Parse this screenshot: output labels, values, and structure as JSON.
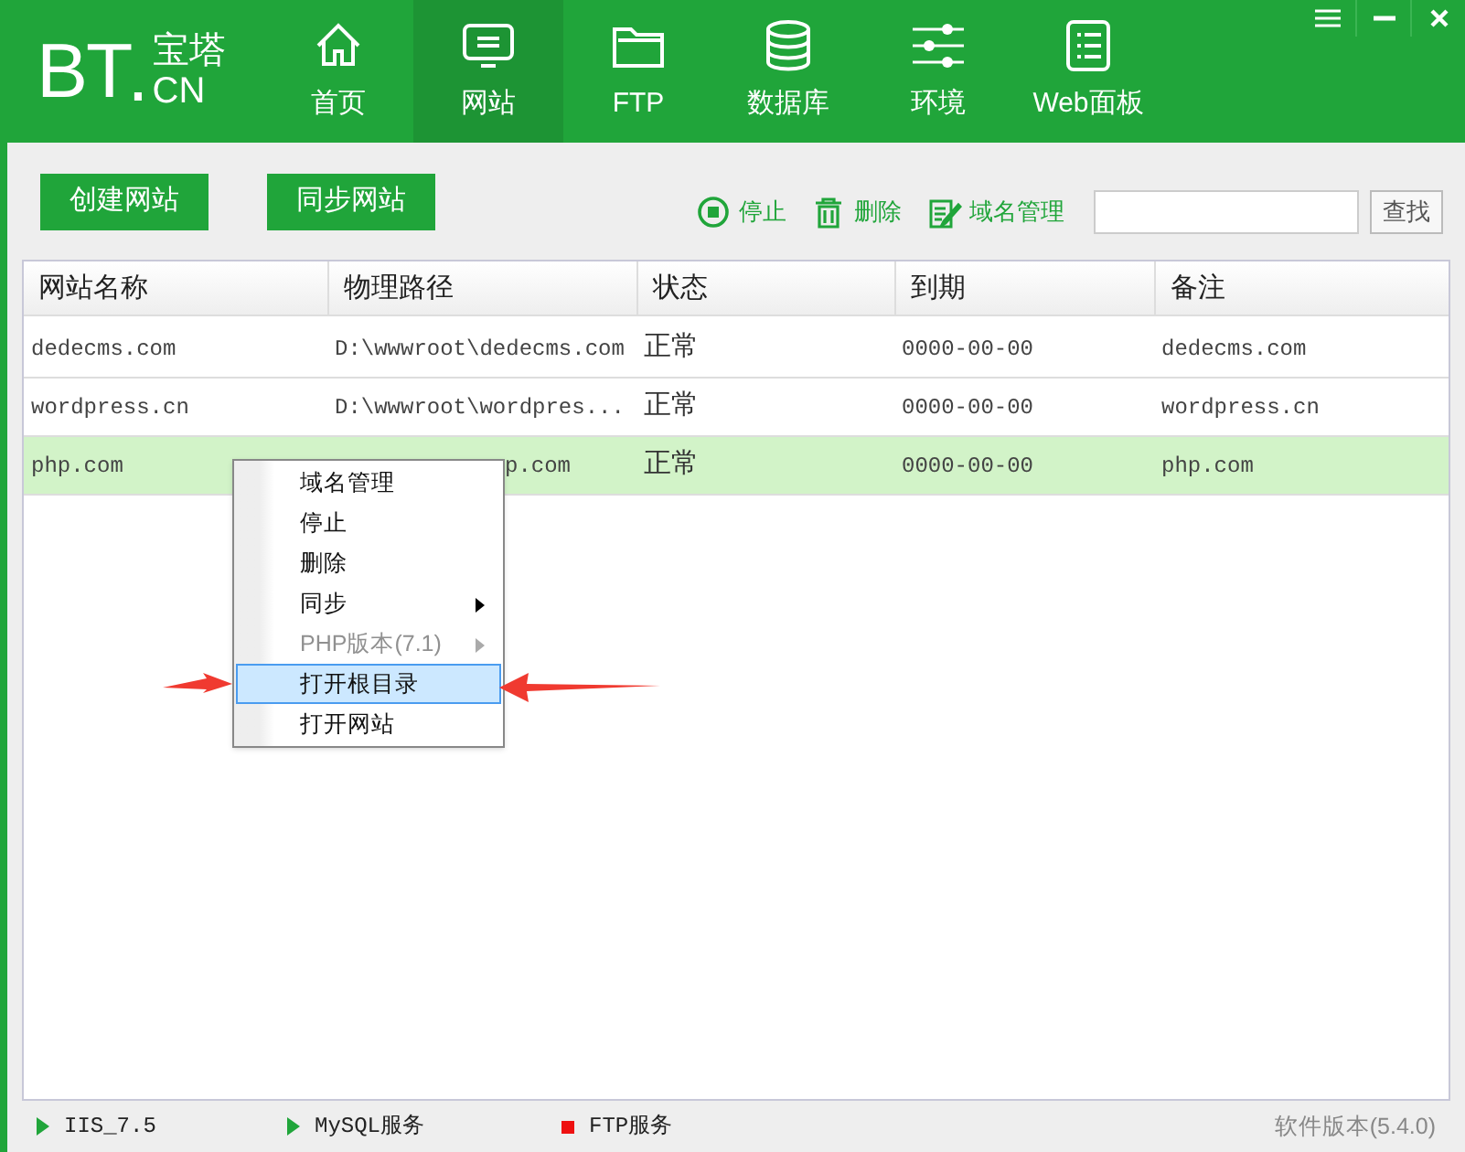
{
  "logo": {
    "letters": "BT",
    "dot": ".",
    "cn_top": "宝塔",
    "cn_bottom": "CN"
  },
  "nav": [
    {
      "label": "首页",
      "selected": false
    },
    {
      "label": "网站",
      "selected": true
    },
    {
      "label": "FTP",
      "selected": false
    },
    {
      "label": "数据库",
      "selected": false
    },
    {
      "label": "环境",
      "selected": false
    },
    {
      "label": "Web面板",
      "selected": false
    }
  ],
  "toolbar": {
    "buttons": [
      "创建网站",
      "同步网站"
    ],
    "actions": [
      {
        "label": "停止"
      },
      {
        "label": "删除"
      },
      {
        "label": "域名管理"
      }
    ],
    "search_button": "查找"
  },
  "table": {
    "columns": [
      "网站名称",
      "物理路径",
      "状态",
      "到期",
      "备注"
    ],
    "rows": [
      {
        "cells": [
          "dedecms.com",
          "D:\\wwwroot\\dedecms.com",
          "正常",
          "0000-00-00",
          "dedecms.com"
        ],
        "selected": false
      },
      {
        "cells": [
          "wordpress.cn",
          "D:\\wwwroot\\wordpres...",
          "正常",
          "0000-00-00",
          "wordpress.cn"
        ],
        "selected": false
      },
      {
        "cells": [
          "php.com",
          "p.com",
          "正常",
          "0000-00-00",
          "php.com"
        ],
        "selected": true
      }
    ]
  },
  "context_menu": [
    {
      "label": "域名管理",
      "submenu": false,
      "disabled": false,
      "selected": false
    },
    {
      "label": "停止",
      "submenu": false,
      "disabled": false,
      "selected": false
    },
    {
      "label": "删除",
      "submenu": false,
      "disabled": false,
      "selected": false
    },
    {
      "label": "同步",
      "submenu": true,
      "disabled": false,
      "selected": false
    },
    {
      "label": "PHP版本(7.1)",
      "submenu": true,
      "disabled": true,
      "selected": false
    },
    {
      "label": "打开根目录",
      "submenu": false,
      "disabled": false,
      "selected": true
    },
    {
      "label": "打开网站",
      "submenu": false,
      "disabled": false,
      "selected": false
    }
  ],
  "status_bar": {
    "services": [
      {
        "label": "IIS_7.5",
        "running": true
      },
      {
        "label": "MySQL服务",
        "running": true
      },
      {
        "label": "FTP服务",
        "running": false
      }
    ],
    "version": "软件版本(5.4.0)"
  }
}
